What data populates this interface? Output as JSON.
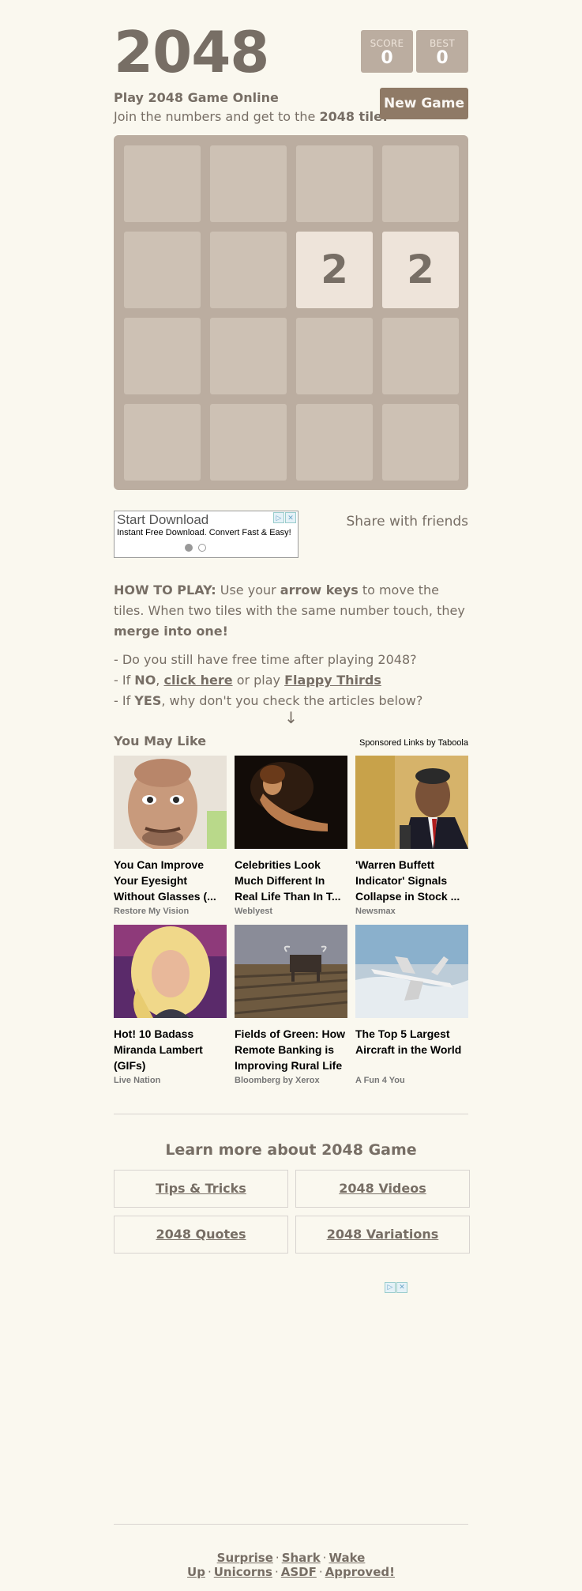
{
  "header": {
    "title": "2048",
    "score_label": "SCORE",
    "score_value": "0",
    "best_label": "BEST",
    "best_value": "0",
    "subtitle": "Play 2048 Game Online",
    "tagline_prefix": "Join the numbers and get to the ",
    "tagline_bold": "2048 tile!",
    "new_game": "New Game"
  },
  "board": {
    "size": 4,
    "tiles": [
      {
        "row": 1,
        "col": 2,
        "value": "2"
      },
      {
        "row": 1,
        "col": 3,
        "value": "2"
      }
    ]
  },
  "ad": {
    "headline": "Start Download",
    "desc": "Instant Free Download. Convert Fast & Easy!"
  },
  "share": "Share with friends",
  "howto": {
    "label": "HOW TO PLAY:",
    "t1": " Use your ",
    "b1": "arrow keys",
    "t2": " to move the tiles. When two tiles with the same number touch, they ",
    "b2": "merge into one!"
  },
  "lines": {
    "l1": "- Do you still have free time after playing 2048?",
    "l2_a": "- If ",
    "l2_no": "NO",
    "l2_b": ", ",
    "l2_link": "click here",
    "l2_c": " or play ",
    "l2_link2": "Flappy Thirds",
    "l3_a": "- If ",
    "l3_yes": "YES",
    "l3_b": ", why don't you check the articles below?",
    "arrow": "↓"
  },
  "taboola": {
    "heading": "You May Like",
    "sponsored": "Sponsored Links by Taboola",
    "cards": [
      {
        "title": "You Can Improve Your Eyesight Without Glasses (...",
        "source": "Restore My Vision"
      },
      {
        "title": "Celebrities Look Much Different In Real Life Than In T...",
        "source": "Weblyest"
      },
      {
        "title": "'Warren Buffett Indicator' Signals Collapse in Stock ...",
        "source": "Newsmax"
      },
      {
        "title": "Hot! 10 Badass Miranda Lambert (GIFs)",
        "source": "Live Nation"
      },
      {
        "title": "Fields of Green: How Remote Banking is Improving Rural Life",
        "source": "Bloomberg by Xerox"
      },
      {
        "title": "The Top 5 Largest Aircraft in the World",
        "source": "A Fun 4 You"
      }
    ]
  },
  "learn": {
    "heading": "Learn more about 2048 Game",
    "links": [
      "Tips & Tricks",
      "2048 Videos",
      "2048 Quotes",
      "2048 Variations"
    ]
  },
  "footer": {
    "links": [
      "Surprise",
      "Shark",
      "Wake Up",
      "Unicorns",
      "ASDF",
      "Approved!"
    ]
  },
  "colors": {
    "background": "#faf8ef",
    "text": "#776e65",
    "board": "#bbada0",
    "empty_cell": "#cdc1b4",
    "tile_2": "#eee4da",
    "button": "#8f7a66"
  }
}
